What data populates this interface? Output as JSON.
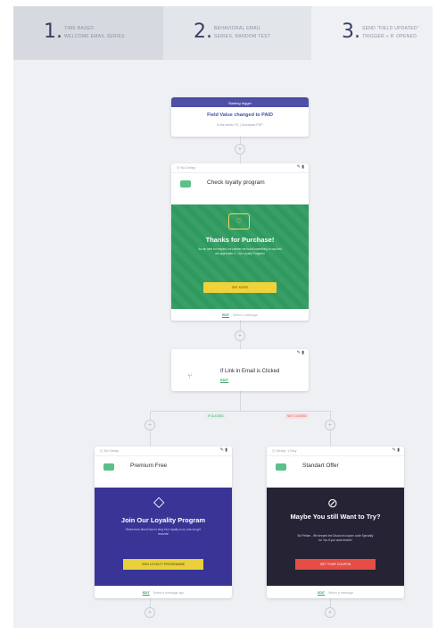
{
  "steps": [
    {
      "num": "1.",
      "line1": "TIME BASED",
      "line2": "WELCOME EMAIL SERIES"
    },
    {
      "num": "2.",
      "line1": "BEHAVIORAL EMAIL",
      "line2": "SERIES, RANDOM TEST"
    },
    {
      "num": "3.",
      "line1": "SEND \"FIELD UPDATED\"",
      "line2": "TRIGGER + IF OPENED"
    }
  ],
  "trigger": {
    "header": "Starting trigger",
    "title": "Field Value changed to PAID",
    "subtitle": "In the series 'F1 | Download PDF'"
  },
  "email1": {
    "delay": "No Delay",
    "name": "Check loyalty program",
    "hero_title": "Thanks for Purchase!",
    "hero_body": "As we care for respect our partner we found something to say that we appreciate it - Our Loyalty Program!",
    "hero_button": "SEE MORE",
    "footer_link": "EDIT",
    "footer_text": "Select a message"
  },
  "condition": {
    "text": "If Link in Email is Clicked",
    "link": "EDIT"
  },
  "branches": {
    "yes": "IF CLICKED",
    "no": "NOT CLICKED"
  },
  "email2": {
    "delay": "No Delay",
    "name": "Premium Free",
    "hero_title": "Join Our Loyality Program",
    "hero_body": "Read more about how to sing Your loyalty to us, has we get rewards!",
    "hero_button": "JOIN LOYALTY PROGRAMME",
    "footer_link": "EDIT",
    "footer_text": "Select a message ago"
  },
  "email3": {
    "delay": "Delay: 1 Day",
    "name": "Standart Offer",
    "hero_title": "Maybe You still Want to Try?",
    "hero_body": "Bo Pellam - We keeped the Discount coupon code Specially for You if you want decide!",
    "hero_button": "GET YOUR COUPON",
    "footer_link": "EDIT",
    "footer_text": "Select a message"
  },
  "icons": {
    "edit": "✎",
    "delete": "▮",
    "clock": "◷",
    "plus": "+"
  }
}
